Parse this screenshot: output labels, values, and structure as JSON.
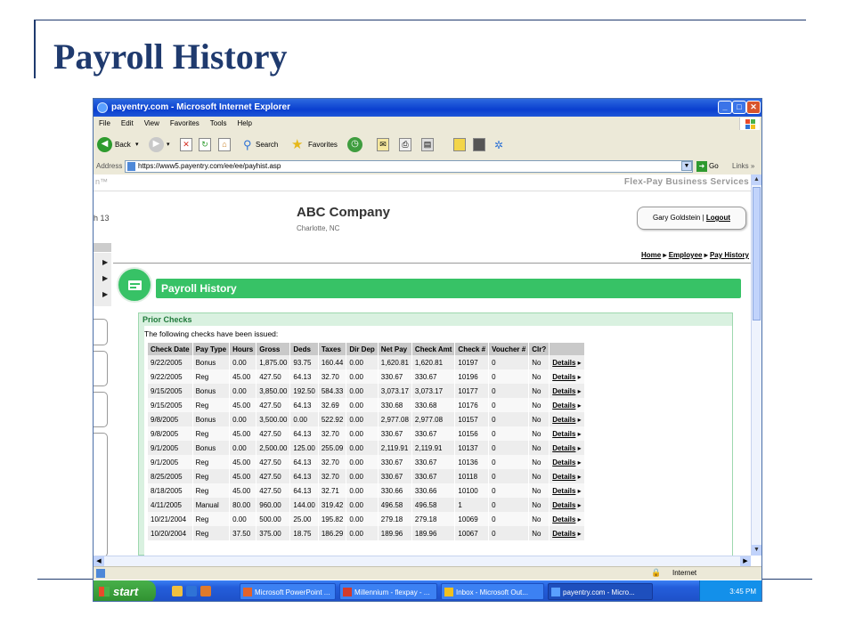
{
  "slide": {
    "title": "Payroll History"
  },
  "browser": {
    "window_title": "payentry.com - Microsoft Internet Explorer",
    "menu": [
      "File",
      "Edit",
      "View",
      "Favorites",
      "Tools",
      "Help"
    ],
    "toolbar": {
      "back": "Back",
      "search": "Search",
      "favorites": "Favorites"
    },
    "address_label": "Address",
    "url": "https://www5.payentry.com/ee/ee/payhist.asp",
    "go": "Go",
    "links": "Links",
    "status_zone": "Internet"
  },
  "page": {
    "header_left": "n™",
    "brand": "Flex-Pay Business Services",
    "side_text": "h 13",
    "company": "ABC Company",
    "city": "Charlotte, NC",
    "user_name": "Gary Goldstein",
    "user_separator": "|",
    "logout": "Logout",
    "breadcrumb": {
      "home": "Home",
      "employee": "Employee",
      "current": "Pay History",
      "sep": "▸"
    },
    "section_title": "Payroll History",
    "prior_checks_title": "Prior Checks",
    "prior_checks_desc": "The following checks have been issued:",
    "columns": [
      "Check Date",
      "Pay Type",
      "Hours",
      "Gross",
      "Deds",
      "Taxes",
      "Dir Dep",
      "Net Pay",
      "Check Amt",
      "Check #",
      "Voucher #",
      "Clr?",
      ""
    ],
    "details_label": "Details",
    "rows": [
      [
        "9/22/2005",
        "Bonus",
        "0.00",
        "1,875.00",
        "93.75",
        "160.44",
        "0.00",
        "1,620.81",
        "1,620.81",
        "10197",
        "0",
        "No"
      ],
      [
        "9/22/2005",
        "Reg",
        "45.00",
        "427.50",
        "64.13",
        "32.70",
        "0.00",
        "330.67",
        "330.67",
        "10196",
        "0",
        "No"
      ],
      [
        "9/15/2005",
        "Bonus",
        "0.00",
        "3,850.00",
        "192.50",
        "584.33",
        "0.00",
        "3,073.17",
        "3,073.17",
        "10177",
        "0",
        "No"
      ],
      [
        "9/15/2005",
        "Reg",
        "45.00",
        "427.50",
        "64.13",
        "32.69",
        "0.00",
        "330.68",
        "330.68",
        "10176",
        "0",
        "No"
      ],
      [
        "9/8/2005",
        "Bonus",
        "0.00",
        "3,500.00",
        "0.00",
        "522.92",
        "0.00",
        "2,977.08",
        "2,977.08",
        "10157",
        "0",
        "No"
      ],
      [
        "9/8/2005",
        "Reg",
        "45.00",
        "427.50",
        "64.13",
        "32.70",
        "0.00",
        "330.67",
        "330.67",
        "10156",
        "0",
        "No"
      ],
      [
        "9/1/2005",
        "Bonus",
        "0.00",
        "2,500.00",
        "125.00",
        "255.09",
        "0.00",
        "2,119.91",
        "2,119.91",
        "10137",
        "0",
        "No"
      ],
      [
        "9/1/2005",
        "Reg",
        "45.00",
        "427.50",
        "64.13",
        "32.70",
        "0.00",
        "330.67",
        "330.67",
        "10136",
        "0",
        "No"
      ],
      [
        "8/25/2005",
        "Reg",
        "45.00",
        "427.50",
        "64.13",
        "32.70",
        "0.00",
        "330.67",
        "330.67",
        "10118",
        "0",
        "No"
      ],
      [
        "8/18/2005",
        "Reg",
        "45.00",
        "427.50",
        "64.13",
        "32.71",
        "0.00",
        "330.66",
        "330.66",
        "10100",
        "0",
        "No"
      ],
      [
        "4/11/2005",
        "Manual",
        "80.00",
        "960.00",
        "144.00",
        "319.42",
        "0.00",
        "496.58",
        "496.58",
        "1",
        "0",
        "No"
      ],
      [
        "10/21/2004",
        "Reg",
        "0.00",
        "500.00",
        "25.00",
        "195.82",
        "0.00",
        "279.18",
        "279.18",
        "10069",
        "0",
        "No"
      ],
      [
        "10/20/2004",
        "Reg",
        "37.50",
        "375.00",
        "18.75",
        "186.29",
        "0.00",
        "189.96",
        "189.96",
        "10067",
        "0",
        "No"
      ]
    ]
  },
  "taskbar": {
    "start": "start",
    "tasks": [
      "Microsoft PowerPoint ...",
      "Millennium - flexpay - ...",
      "Inbox - Microsoft Out...",
      "payentry.com - Micro..."
    ],
    "clock": "3:45 PM"
  }
}
